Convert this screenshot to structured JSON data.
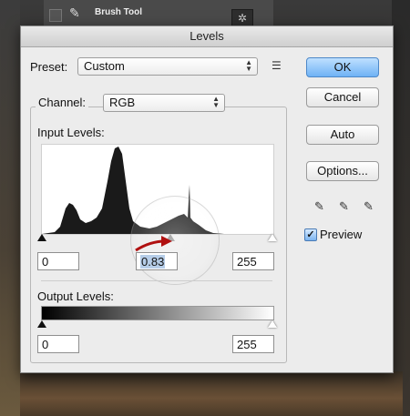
{
  "background": {
    "layer_name": "Brush Tool"
  },
  "dialog": {
    "title": "Levels",
    "preset_label": "Preset:",
    "preset_value": "Custom",
    "channel_label": "Channel:",
    "channel_value": "RGB",
    "input_levels_label": "Input Levels:",
    "input_black": "0",
    "input_gamma": "0.83",
    "input_white": "255",
    "output_levels_label": "Output Levels:",
    "output_black": "0",
    "output_white": "255",
    "buttons": {
      "ok": "OK",
      "cancel": "Cancel",
      "auto": "Auto",
      "options": "Options..."
    },
    "preview_label": "Preview",
    "preview_checked": true,
    "accent_color": "#6fb2f5",
    "annotation_arrow_color": "#b01010"
  },
  "icons": {
    "brush": "brush-icon",
    "layer_visibility": "eye-icon",
    "preset_menu": "preset-menu-icon",
    "eyedropper_black": "eyedropper-icon",
    "eyedropper_gray": "eyedropper-icon",
    "eyedropper_white": "eyedropper-icon"
  }
}
